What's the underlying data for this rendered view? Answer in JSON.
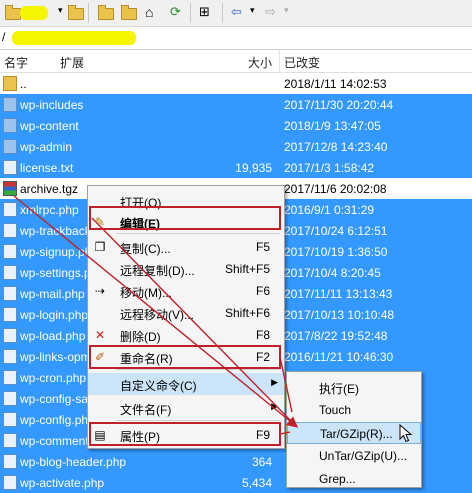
{
  "toolbar": {
    "buttons": [
      "folder-open-icon",
      "folder-icon",
      "folder-icon",
      "folder-icon",
      "home-icon",
      "refresh-icon",
      "tree-icon",
      "back-arrow-icon",
      "forward-arrow-icon"
    ]
  },
  "path": {
    "text": "/"
  },
  "columns": {
    "name": "名字",
    "ext": "扩展",
    "size": "大小",
    "modified": "已改变"
  },
  "files": [
    {
      "name": "..",
      "size": "",
      "modified": "2018/1/11 14:02:53",
      "type": "up",
      "selected": false
    },
    {
      "name": "wp-includes",
      "size": "",
      "modified": "2017/11/30 20:20:44",
      "type": "folder",
      "selected": true
    },
    {
      "name": "wp-content",
      "size": "",
      "modified": "2018/1/9 13:47:05",
      "type": "folder",
      "selected": true
    },
    {
      "name": "wp-admin",
      "size": "",
      "modified": "2017/12/8 14:23:40",
      "type": "folder",
      "selected": true
    },
    {
      "name": "license.txt",
      "size": "19,935",
      "modified": "2017/1/3 1:58:42",
      "type": "file",
      "selected": true
    },
    {
      "name": "archive.tgz",
      "size": "",
      "modified": "2017/11/6 20:02:08",
      "type": "archive",
      "selected": false
    },
    {
      "name": "xmlrpc.php",
      "size": "",
      "modified": "2016/9/1 0:31:29",
      "type": "file",
      "selected": true
    },
    {
      "name": "wp-trackback.php",
      "size": "",
      "modified": "2017/10/24 6:12:51",
      "type": "file",
      "selected": true
    },
    {
      "name": "wp-signup.php",
      "size": "",
      "modified": "2017/10/19 1:36:50",
      "type": "file",
      "selected": true
    },
    {
      "name": "wp-settings.php",
      "size": "",
      "modified": "2017/10/4 8:20:45",
      "type": "file",
      "selected": true
    },
    {
      "name": "wp-mail.php",
      "size": "",
      "modified": "2017/11/11 13:13:43",
      "type": "file",
      "selected": true
    },
    {
      "name": "wp-login.php",
      "size": "",
      "modified": "2017/10/13 10:10:48",
      "type": "file",
      "selected": true
    },
    {
      "name": "wp-load.php",
      "size": "",
      "modified": "2017/8/22 19:52:48",
      "type": "file",
      "selected": true
    },
    {
      "name": "wp-links-opml.php",
      "size": "",
      "modified": "2016/11/21 10:46:30",
      "type": "file",
      "selected": true
    },
    {
      "name": "wp-cron.php",
      "size": "",
      "modified": "",
      "type": "file",
      "selected": true
    },
    {
      "name": "wp-config-sample.php",
      "size": "",
      "modified": "",
      "type": "file",
      "selected": true
    },
    {
      "name": "wp-config.php",
      "size": "",
      "modified": "",
      "type": "file",
      "selected": true
    },
    {
      "name": "wp-comments-post.php",
      "size": "",
      "modified": "",
      "type": "file",
      "selected": true
    },
    {
      "name": "wp-blog-header.php",
      "size": "364",
      "modified": "",
      "type": "file",
      "selected": true
    },
    {
      "name": "wp-activate.php",
      "size": "5,434",
      "modified": "",
      "type": "file",
      "selected": true
    }
  ],
  "context_menu": {
    "items": [
      {
        "label": "打开(O)",
        "shortcut": "",
        "icon": "open-icon",
        "bold": false
      },
      {
        "label": "编辑(E)",
        "shortcut": "",
        "icon": "edit-icon",
        "bold": true
      },
      {
        "label": "复制(C)...",
        "shortcut": "F5",
        "icon": "copy-icon",
        "bold": false
      },
      {
        "label": "远程复制(D)...",
        "shortcut": "Shift+F5",
        "icon": "",
        "bold": false
      },
      {
        "label": "移动(M)...",
        "shortcut": "F6",
        "icon": "move-icon",
        "bold": false
      },
      {
        "label": "远程移动(V)...",
        "shortcut": "Shift+F6",
        "icon": "",
        "bold": false
      },
      {
        "label": "删除(D)",
        "shortcut": "F8",
        "icon": "delete-icon",
        "bold": false
      },
      {
        "label": "重命名(R)",
        "shortcut": "F2",
        "icon": "rename-icon",
        "bold": false
      },
      {
        "label": "自定义命令(C)",
        "shortcut": "",
        "icon": "",
        "bold": false
      },
      {
        "label": "文件名(F)",
        "shortcut": "",
        "icon": "",
        "bold": false
      },
      {
        "label": "属性(P)",
        "shortcut": "F9",
        "icon": "properties-icon",
        "bold": false
      }
    ]
  },
  "submenu": {
    "items": [
      "执行(E)",
      "Touch",
      "Tar/GZip(R)...",
      "UnTar/GZip(U)...",
      "Grep..."
    ]
  },
  "colors": {
    "selection": "#3399ff",
    "highlight_box": "#c0202a",
    "menu_hover": "#cce4f7"
  }
}
